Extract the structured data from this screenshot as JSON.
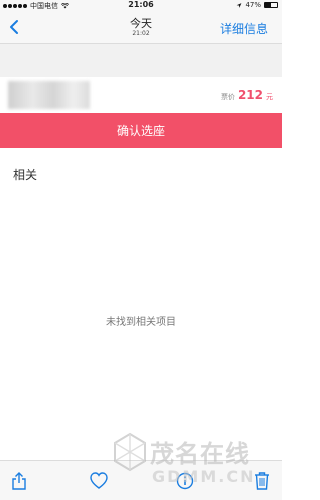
{
  "status_bar": {
    "carrier": "中国电信",
    "time": "21:06",
    "battery_percent": "47%",
    "battery_level": 0.47
  },
  "nav": {
    "back_icon": "chevron-left-icon",
    "title": "今天",
    "subtitle": "21:02",
    "action_label": "详细信息",
    "accent_color": "#1a7de0"
  },
  "info": {
    "price_label": "票价",
    "price_value": "212",
    "price_unit": "元",
    "price_color": "#f0506e"
  },
  "confirm_button": {
    "label": "确认选座",
    "color": "#f25068"
  },
  "related": {
    "title": "相关",
    "empty_message": "未找到相关项目"
  },
  "toolbar": {
    "icons": [
      "share-icon",
      "heart-icon",
      "info-icon",
      "trash-icon"
    ]
  },
  "watermark": {
    "brand": "茂名在线",
    "domain": "GDMM.CN"
  }
}
